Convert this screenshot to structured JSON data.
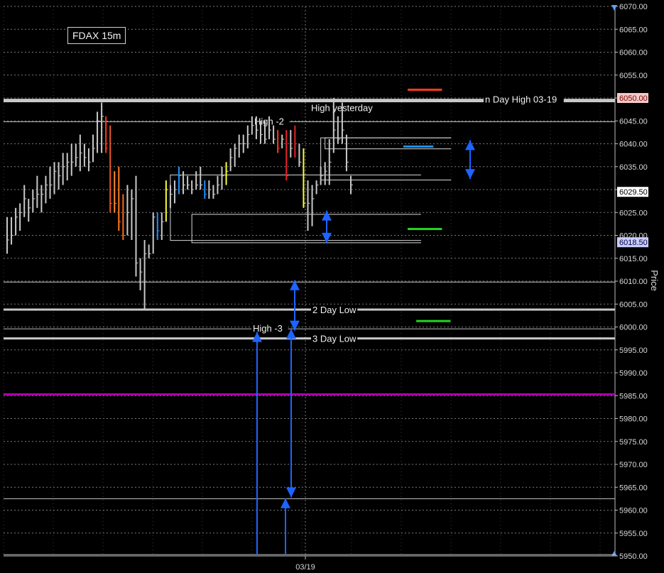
{
  "chart_data": {
    "type": "ohlc",
    "title": "FDAX 15m",
    "y_axis_label": "Price",
    "x_tick_label": "03/19",
    "ylim": [
      5950,
      6070
    ],
    "y_ticks": [
      "6070.00",
      "6065.00",
      "6060.00",
      "6055.00",
      "6050.00",
      "6045.00",
      "6040.00",
      "6035.00",
      "6030.00",
      "6025.00",
      "6020.00",
      "6015.00",
      "6010.00",
      "6005.00",
      "6000.00",
      "5995.00",
      "5990.00",
      "5985.00",
      "5980.00",
      "5975.00",
      "5970.00",
      "5965.00",
      "5960.00",
      "5955.00",
      "5950.00"
    ],
    "price_markers": [
      {
        "label": "6050.00",
        "value": 6050.0,
        "bg": "#f4c9c9",
        "fg": "#7a0000"
      },
      {
        "label": "6029.50",
        "value": 6029.5,
        "bg": "#ffffff",
        "fg": "#000000"
      },
      {
        "label": "6018.50",
        "value": 6018.5,
        "bg": "#c9cdf6",
        "fg": "#000050"
      }
    ],
    "horizontal_levels": [
      {
        "label": "n Day High 03-19",
        "value": 6049.6,
        "color": "#c8c8c8"
      },
      {
        "label": "High yesterday",
        "value": 6049.3,
        "color": "#c8c8c8"
      },
      {
        "label": "High -2",
        "value": 6044.8,
        "color": "#bdbdbd"
      },
      {
        "label": "",
        "value": 6009.8,
        "color": "#c8c8c8"
      },
      {
        "label": "2 Day Low",
        "value": 6003.8,
        "color": "#c8c8c8"
      },
      {
        "label": "High -3",
        "value": 5999.6,
        "color": "#bdbdbd"
      },
      {
        "label": "3 Day Low",
        "value": 5997.5,
        "color": "#c8c8c8"
      },
      {
        "label": "",
        "value": 5985.3,
        "color": "#b000b0"
      },
      {
        "label": "",
        "value": 5962.5,
        "color": "#c8c8c8"
      },
      {
        "label": "",
        "value": 5950.3,
        "color": "#c8c8c8"
      }
    ],
    "bars": [
      {
        "h": 6024,
        "l": 6016,
        "c": 6019,
        "color": "#c8c8c8"
      },
      {
        "h": 6024,
        "l": 6018,
        "c": 6020,
        "color": "#c8c8c8"
      },
      {
        "h": 6026,
        "l": 6020,
        "c": 6024,
        "color": "#c8c8c8"
      },
      {
        "h": 6027,
        "l": 6021,
        "c": 6025,
        "color": "#c8c8c8"
      },
      {
        "h": 6031,
        "l": 6024,
        "c": 6028,
        "color": "#c8c8c8"
      },
      {
        "h": 6028,
        "l": 6023,
        "c": 6026,
        "color": "#c8c8c8"
      },
      {
        "h": 6030,
        "l": 6025,
        "c": 6028,
        "color": "#c8c8c8"
      },
      {
        "h": 6033,
        "l": 6026,
        "c": 6029,
        "color": "#c8c8c8"
      },
      {
        "h": 6031,
        "l": 6025,
        "c": 6029,
        "color": "#c8c8c8"
      },
      {
        "h": 6033,
        "l": 6027,
        "c": 6031,
        "color": "#c8c8c8"
      },
      {
        "h": 6035,
        "l": 6028,
        "c": 6031,
        "color": "#c8c8c8"
      },
      {
        "h": 6036,
        "l": 6029,
        "c": 6034,
        "color": "#c8c8c8"
      },
      {
        "h": 6036,
        "l": 6030,
        "c": 6033,
        "color": "#c8c8c8"
      },
      {
        "h": 6038,
        "l": 6031,
        "c": 6035,
        "color": "#c8c8c8"
      },
      {
        "h": 6038,
        "l": 6032,
        "c": 6036,
        "color": "#c8c8c8"
      },
      {
        "h": 6040,
        "l": 6033,
        "c": 6036,
        "color": "#c8c8c8"
      },
      {
        "h": 6040,
        "l": 6035,
        "c": 6037,
        "color": "#c8c8c8"
      },
      {
        "h": 6042,
        "l": 6034,
        "c": 6038,
        "color": "#c8c8c8"
      },
      {
        "h": 6040,
        "l": 6035,
        "c": 6037,
        "color": "#c8c8c8"
      },
      {
        "h": 6039,
        "l": 6034,
        "c": 6036,
        "color": "#c8c8c8"
      },
      {
        "h": 6042,
        "l": 6036,
        "c": 6039,
        "color": "#c8c8c8"
      },
      {
        "h": 6047,
        "l": 6038,
        "c": 6045,
        "color": "#c8c8c8"
      },
      {
        "h": 6049,
        "l": 6038,
        "c": 6046,
        "color": "#c8c8c8"
      },
      {
        "h": 6046,
        "l": 6038,
        "c": 6039,
        "color": "#ff3b1f"
      },
      {
        "h": 6044,
        "l": 6025,
        "c": 6027,
        "color": "#e8572a"
      },
      {
        "h": 6034,
        "l": 6025,
        "c": 6027,
        "color": "#ff8a2a"
      },
      {
        "h": 6035,
        "l": 6021,
        "c": 6023,
        "color": "#ff7a1a"
      },
      {
        "h": 6029,
        "l": 6019,
        "c": 6020,
        "color": "#ff6a1a"
      },
      {
        "h": 6031,
        "l": 6020,
        "c": 6025,
        "color": "#c8c8c8"
      },
      {
        "h": 6030,
        "l": 6019,
        "c": 6028,
        "color": "#c8c8c8"
      },
      {
        "h": 6033,
        "l": 6011,
        "c": 6014,
        "color": "#c8c8c8"
      },
      {
        "h": 6015,
        "l": 6008,
        "c": 6012,
        "color": "#c8c8c8"
      },
      {
        "h": 6019,
        "l": 6004,
        "c": 6016,
        "color": "#c8c8c8"
      },
      {
        "h": 6018,
        "l": 6015,
        "c": 6016,
        "color": "#c8c8c8"
      },
      {
        "h": 6025,
        "l": 6016,
        "c": 6024,
        "color": "#c8c8c8"
      },
      {
        "h": 6025,
        "l": 6019,
        "c": 6021,
        "color": "#1e90ff"
      },
      {
        "h": 6025,
        "l": 6019,
        "c": 6023,
        "color": "#c8c8c8"
      },
      {
        "h": 6032,
        "l": 6023,
        "c": 6030,
        "color": "#ffff33"
      },
      {
        "h": 6031,
        "l": 6026,
        "c": 6029,
        "color": "#c8c8c8"
      },
      {
        "h": 6032,
        "l": 6027,
        "c": 6030,
        "color": "#c8c8c8"
      },
      {
        "h": 6035,
        "l": 6029,
        "c": 6033,
        "color": "#1e90ff"
      },
      {
        "h": 6034,
        "l": 6029,
        "c": 6031,
        "color": "#c8c8c8"
      },
      {
        "h": 6033,
        "l": 6030,
        "c": 6031,
        "color": "#c8c8c8"
      },
      {
        "h": 6032,
        "l": 6029,
        "c": 6030,
        "color": "#c8c8c8"
      },
      {
        "h": 6034,
        "l": 6030,
        "c": 6031,
        "color": "#c8c8c8"
      },
      {
        "h": 6035,
        "l": 6030,
        "c": 6031,
        "color": "#c8c8c8"
      },
      {
        "h": 6032,
        "l": 6028,
        "c": 6029,
        "color": "#1e90ff"
      },
      {
        "h": 6032,
        "l": 6028,
        "c": 6030,
        "color": "#c8c8c8"
      },
      {
        "h": 6031,
        "l": 6028,
        "c": 6029,
        "color": "#c8c8c8"
      },
      {
        "h": 6033,
        "l": 6029,
        "c": 6031,
        "color": "#c8c8c8"
      },
      {
        "h": 6035,
        "l": 6030,
        "c": 6033,
        "color": "#c8c8c8"
      },
      {
        "h": 6036,
        "l": 6031,
        "c": 6034,
        "color": "#ffff33"
      },
      {
        "h": 6039,
        "l": 6034,
        "c": 6037,
        "color": "#c8c8c8"
      },
      {
        "h": 6040,
        "l": 6035,
        "c": 6039,
        "color": "#c8c8c8"
      },
      {
        "h": 6042,
        "l": 6037,
        "c": 6040,
        "color": "#c8c8c8"
      },
      {
        "h": 6042,
        "l": 6038,
        "c": 6040,
        "color": "#c8c8c8"
      },
      {
        "h": 6044,
        "l": 6039,
        "c": 6042,
        "color": "#c8c8c8"
      },
      {
        "h": 6046,
        "l": 6042,
        "c": 6044,
        "color": "#c8c8c8"
      },
      {
        "h": 6046,
        "l": 6041,
        "c": 6043,
        "color": "#c8c8c8"
      },
      {
        "h": 6045,
        "l": 6040,
        "c": 6042,
        "color": "#c8c8c8"
      },
      {
        "h": 6045,
        "l": 6040,
        "c": 6041,
        "color": "#c8c8c8"
      },
      {
        "h": 6046,
        "l": 6041,
        "c": 6043,
        "color": "#c8c8c8"
      },
      {
        "h": 6044,
        "l": 6040,
        "c": 6041,
        "color": "#c8c8c8"
      },
      {
        "h": 6043,
        "l": 6038,
        "c": 6039,
        "color": "#ff3b1f"
      },
      {
        "h": 6042,
        "l": 6039,
        "c": 6041,
        "color": "#c8c8c8"
      },
      {
        "h": 6043,
        "l": 6032,
        "c": 6033,
        "color": "#e8202a"
      },
      {
        "h": 6043,
        "l": 6037,
        "c": 6039,
        "color": "#c8c8c8"
      },
      {
        "h": 6044,
        "l": 6037,
        "c": 6040,
        "color": "#e8202a"
      },
      {
        "h": 6040,
        "l": 6035,
        "c": 6036,
        "color": "#c8c8c8"
      },
      {
        "h": 6039,
        "l": 6026,
        "c": 6027,
        "color": "#ffff33"
      },
      {
        "h": 6032,
        "l": 6021,
        "c": 6027,
        "color": "#c8c8c8"
      },
      {
        "h": 6031,
        "l": 6022,
        "c": 6028,
        "color": "#c8c8c8"
      },
      {
        "h": 6032,
        "l": 6029,
        "c": 6031,
        "color": "#c8c8c8"
      },
      {
        "h": 6035,
        "l": 6031,
        "c": 6033,
        "color": "#c8c8c8"
      },
      {
        "h": 6036,
        "l": 6031,
        "c": 6034,
        "color": "#c8c8c8"
      },
      {
        "h": 6041,
        "l": 6031,
        "c": 6036,
        "color": "#c8c8c8"
      },
      {
        "h": 6050,
        "l": 6038,
        "c": 6043,
        "color": "#c8c8c8"
      },
      {
        "h": 6046,
        "l": 6040,
        "c": 6041,
        "color": "#c8c8c8"
      },
      {
        "h": 6049,
        "l": 6040,
        "c": 6043,
        "color": "#c8c8c8"
      },
      {
        "h": 6042,
        "l": 6034,
        "c": 6036,
        "color": "#c8c8c8"
      },
      {
        "h": 6033,
        "l": 6029,
        "c": 6031,
        "color": "#c8c8c8"
      }
    ],
    "annotations": {
      "boxes": [
        {
          "from_bar": 38,
          "to_bar": 98,
          "top": 6033.2,
          "bottom": 6018.9
        },
        {
          "from_bar": 43,
          "to_bar": 98,
          "top": 6024.6,
          "bottom": 6018.4
        },
        {
          "from_bar": 73,
          "to_bar": 105,
          "top": 6041.3,
          "bottom": 6032.1
        },
        {
          "from_bar": 74,
          "to_bar": 105,
          "top": 6041.3,
          "bottom": 6038.9
        }
      ],
      "double_arrows": [
        {
          "x_bar": 64,
          "from": 6025.4,
          "to": 6018.4
        },
        {
          "x_bar": 94,
          "from": 6040.8,
          "to": 6032.3
        },
        {
          "x_bar": 58,
          "from": 6010.2,
          "to": 5999.2
        },
        {
          "x_bar": 58,
          "from": 5999.6,
          "to": 5962.8
        }
      ],
      "up_arrows": [
        {
          "x_bar": 51,
          "from": 5950.3,
          "to": 5998.9
        },
        {
          "x_bar": 56,
          "from": 5950.3,
          "to": 5962.6
        }
      ],
      "ticks": [
        {
          "x_bar_from": 80,
          "x_bar_to": 88,
          "value": 6051.8,
          "color": "#ff3b1f"
        },
        {
          "x_bar_from": 79,
          "x_bar_to": 86,
          "value": 6039.4,
          "color": "#1e90ff"
        },
        {
          "x_bar_from": 80,
          "x_bar_to": 88,
          "value": 6021.4,
          "color": "#22d422"
        },
        {
          "x_bar_from": 82,
          "x_bar_to": 90,
          "value": 6001.3,
          "color": "#22d422"
        }
      ]
    },
    "colors": {
      "grid": "#7a7a7a",
      "panel_bg": "#000000",
      "text": "#e6e6e6",
      "accent_blue": "#1e63ff"
    }
  }
}
